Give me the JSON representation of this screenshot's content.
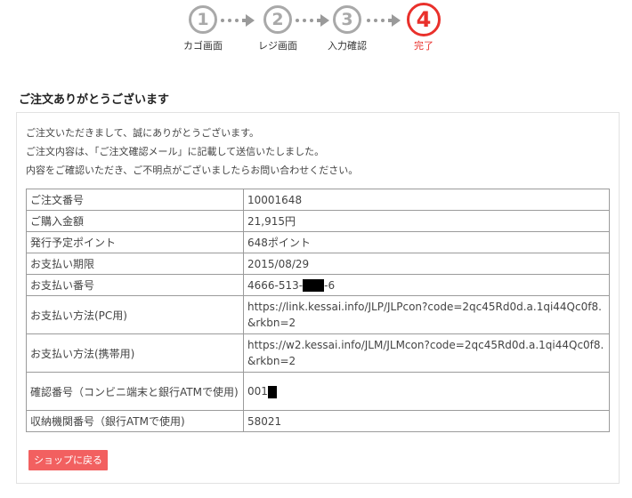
{
  "steps": [
    {
      "num": "1",
      "label": "カゴ画面"
    },
    {
      "num": "2",
      "label": "レジ画面"
    },
    {
      "num": "3",
      "label": "入力確認"
    },
    {
      "num": "4",
      "label": "完了"
    }
  ],
  "colors": {
    "active": "#e9302b",
    "inactive": "#a9a9a9",
    "button": "#f26060"
  },
  "title": "ご注文ありがとうございます",
  "intro": [
    "ご注文いただきまして、誠にありがとうございます。",
    "ご注文内容は、「ご注文確認メール」に記載して送信いたしました。",
    "内容をご確認いただき、ご不明点がございましたらお問い合わせください。"
  ],
  "order_table": {
    "rows": [
      {
        "label": "ご注文番号",
        "value": "10001648"
      },
      {
        "label": "ご購入金額",
        "value": "21,915円"
      },
      {
        "label": "発行予定ポイント",
        "value": "648ポイント"
      },
      {
        "label": "お支払い期限",
        "value": "2015/08/29"
      },
      {
        "label": "お支払い番号",
        "value_prefix": "4666-513-",
        "value_suffix": "-6"
      },
      {
        "label": "お支払い方法(PC用)",
        "value": "https://link.kessai.info/JLP/JLPcon?code=2qc45Rd0d.a.1qi44Qc0f8.&rkbn=2"
      },
      {
        "label": "お支払い方法(携帯用)",
        "value": "https://w2.kessai.info/JLM/JLMcon?code=2qc45Rd0d.a.1qi44Qc0f8.&rkbn=2"
      },
      {
        "label": "確認番号（コンビニ端末と銀行ATMで使用)",
        "value_prefix": "001"
      },
      {
        "label": "収納機関番号（銀行ATMで使用)",
        "value": "58021"
      }
    ]
  },
  "back_button": "ショップに戻る"
}
